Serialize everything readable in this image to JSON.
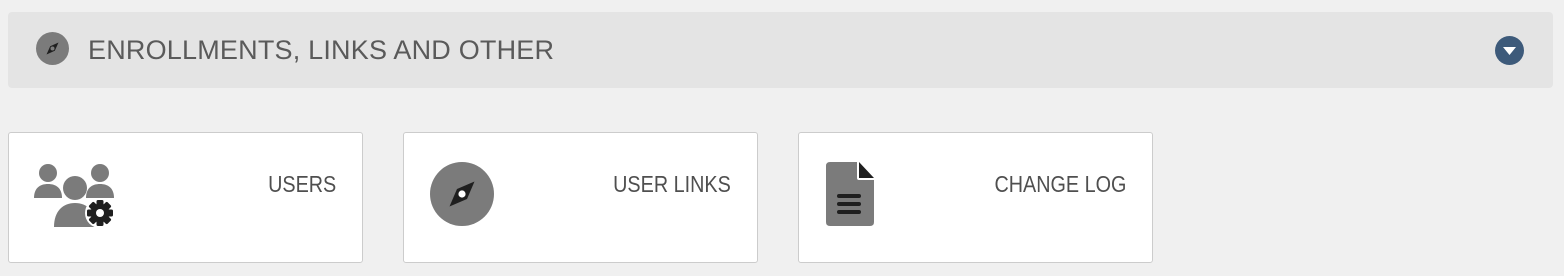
{
  "section": {
    "title": "ENROLLMENTS, LINKS AND OTHER",
    "icon": "compass-icon",
    "toggle_icon": "chevron-down-circle-icon",
    "colors": {
      "header_bg": "#e4e4e4",
      "title_text": "#5a5a5a",
      "toggle": "#3d5a7a",
      "icon_gray": "#7b7b7b"
    }
  },
  "tiles": [
    {
      "label": "USERS",
      "icon": "users-gear-icon"
    },
    {
      "label": "USER LINKS",
      "icon": "compass-icon"
    },
    {
      "label": "CHANGE LOG",
      "icon": "document-icon"
    }
  ]
}
